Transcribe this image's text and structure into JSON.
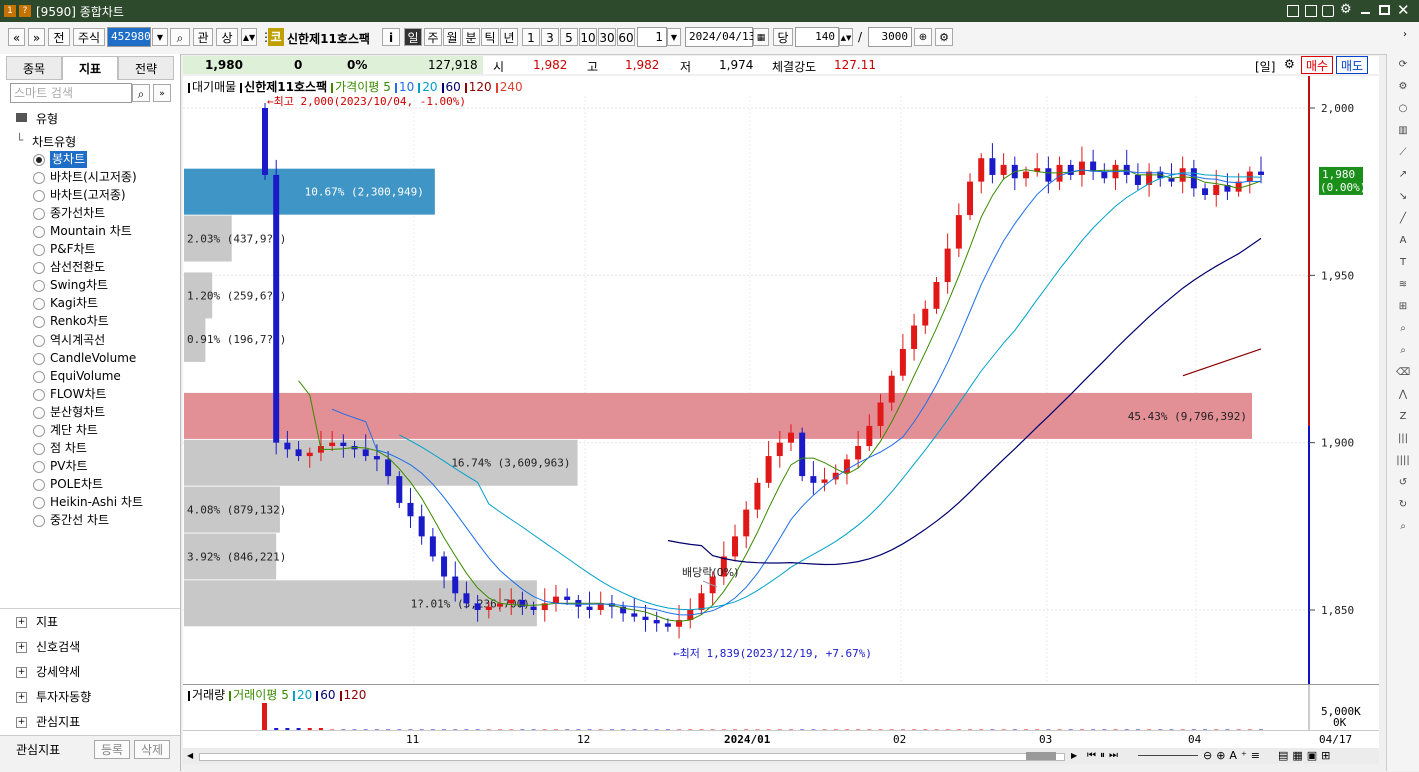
{
  "window": {
    "title": "[9590] 종합차트",
    "icon_labels": [
      "1",
      "?"
    ]
  },
  "toolbar": {
    "nav_prev": "«",
    "nav_next": "»",
    "btn_jeon": "전",
    "btn_jusik": "주식",
    "code_value": "452980",
    "btn_gwan": "관",
    "btn_sang": "상",
    "market_badge": "코",
    "stock_name": "신한제11호스팩",
    "btn_info": "i",
    "periods": [
      "일",
      "주",
      "월",
      "분",
      "틱",
      "년"
    ],
    "intervals": [
      "1",
      "3",
      "5",
      "10",
      "30",
      "60"
    ],
    "interval_value": "1",
    "date_value": "2024/04/13",
    "btn_dang": "당",
    "count_value": "140",
    "slash": "/",
    "max_value": "3000"
  },
  "left_panel": {
    "tabs": [
      "종목",
      "지표",
      "전략"
    ],
    "search_placeholder": "스마트 검색",
    "root": "유형",
    "group": "차트유형",
    "chart_types": [
      "봉차트",
      "바차트(시고저종)",
      "바차트(고저종)",
      "종가선차트",
      "Mountain 차트",
      "P&F차트",
      "삼선전환도",
      "Swing차트",
      "Kagi차트",
      "Renko차트",
      "역시계곡선",
      "CandleVolume",
      "EquiVolume",
      "FLOW차트",
      "분산형차트",
      "계단 차트",
      "점 차트",
      "PV차트",
      "POLE차트",
      "Heikin-Ashi 차트",
      "중간선 차트"
    ],
    "categories": [
      "지표",
      "신호검색",
      "강세약세",
      "투자자동향",
      "관심지표"
    ],
    "footer_label": "관심지표",
    "btn_register": "등록",
    "btn_delete": "삭제"
  },
  "quote": {
    "price": "1,980",
    "change": "0",
    "rate": "0%",
    "volume": "127,918",
    "open_label": "시",
    "open": "1,982",
    "high_label": "고",
    "high": "1,982",
    "low_label": "저",
    "low": "1,974",
    "strength_label": "체결강도",
    "strength": "127.11",
    "period_tag": "[일]",
    "btn_buy": "매수",
    "btn_sell": "매도"
  },
  "chart_legend": {
    "items": [
      {
        "text": "대기매물",
        "color": "#000000"
      },
      {
        "text": "신한제11호스팩",
        "color": "#000000"
      },
      {
        "text": "가격이평",
        "color": "#3a8a00"
      },
      {
        "text": "5",
        "color": "#3a8a00"
      },
      {
        "text": "10",
        "color": "#1e6ee6"
      },
      {
        "text": "20",
        "color": "#00a0c8"
      },
      {
        "text": "60",
        "color": "#00006e"
      },
      {
        "text": "120",
        "color": "#8a0000"
      },
      {
        "text": "240",
        "color": "#e0402e"
      }
    ]
  },
  "annotations": {
    "high": "최고 2,000(2023/10/04, -1.00%)",
    "low": "최저 1,839(2023/12/19, +7.67%)",
    "dividend": "배당락(0%)"
  },
  "current_price_tag": {
    "price": "1,980",
    "rate": "(0.00%)"
  },
  "volume_pane": {
    "legend": [
      "거래량",
      "거래이평",
      "5",
      "20",
      "60",
      "120"
    ],
    "axis_labels": [
      "5,000K",
      "0K"
    ]
  },
  "chart_data": {
    "type": "candlestick",
    "ylim": [
      1830,
      2010
    ],
    "y_ticks": [
      "2,000",
      "1,950",
      "1,900",
      "1,850"
    ],
    "x_labels": [
      "11",
      "12",
      "2024/01",
      "02",
      "03",
      "04"
    ],
    "x_last": "04/17",
    "volume_profile": [
      {
        "price": 1975,
        "label": "10.67% (2,300,949)",
        "pct": 10.67
      },
      {
        "price": 1961,
        "label": "2.03% (437,9?5)",
        "pct": 2.03
      },
      {
        "price": 1944,
        "label": "1.20% (259,6?3)",
        "pct": 1.2
      },
      {
        "price": 1931,
        "label": "0.91% (196,7?3)",
        "pct": 0.91
      },
      {
        "price": 1908,
        "label": "45.43% (9,796,392)",
        "pct": 45.43
      },
      {
        "price": 1894,
        "label": "16.74% (3,609,963)",
        "pct": 16.74
      },
      {
        "price": 1880,
        "label": "4.08% (879,132)",
        "pct": 4.08
      },
      {
        "price": 1866,
        "label": "3.92% (846,221)",
        "pct": 3.92
      },
      {
        "price": 1852,
        "label": "1?.01% (3,236,700)",
        "pct": 15.01
      }
    ],
    "close_trend": [
      1980,
      1900,
      1898,
      1896,
      1897,
      1899,
      1900,
      1899,
      1898,
      1896,
      1895,
      1890,
      1882,
      1878,
      1872,
      1866,
      1860,
      1855,
      1852,
      1850,
      1851,
      1852,
      1853,
      1851,
      1850,
      1852,
      1854,
      1853,
      1851,
      1850,
      1852,
      1851,
      1849,
      1848,
      1847,
      1846,
      1845,
      1847,
      1850,
      1855,
      1860,
      1866,
      1872,
      1880,
      1888,
      1896,
      1900,
      1903,
      1890,
      1888,
      1889,
      1891,
      1895,
      1899,
      1905,
      1912,
      1920,
      1928,
      1935,
      1940,
      1948,
      1958,
      1968,
      1978,
      1985,
      1980,
      1983,
      1979,
      1981,
      1982,
      1978,
      1983,
      1980,
      1984,
      1981,
      1979,
      1983,
      1980,
      1977,
      1981,
      1979,
      1978,
      1982,
      1976,
      1974,
      1977,
      1975,
      1978,
      1981,
      1980
    ],
    "ma_end_values": {
      "ma5": 1980,
      "ma10": 1979,
      "ma20": 1980,
      "ma60": 1952,
      "ma120": 1928
    }
  }
}
